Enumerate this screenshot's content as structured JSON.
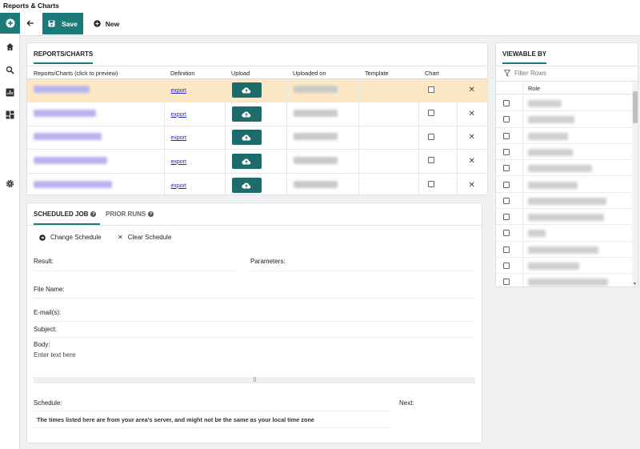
{
  "app": {
    "title": "Reports & Charts"
  },
  "colors": {
    "accent": "#1d7a7a",
    "selected_row": "#fde8c6",
    "link": "#2323cc"
  },
  "nav": {
    "add_icon": "plus-circle-icon",
    "items": [
      {
        "icon": "home-icon"
      },
      {
        "icon": "search-icon"
      },
      {
        "icon": "bar-chart-icon"
      },
      {
        "icon": "dashboard-icon"
      },
      {
        "icon": "gear-icon"
      }
    ]
  },
  "toolbar": {
    "back_icon": "arrow-left-icon",
    "save_label": "Save",
    "new_label": "New"
  },
  "reports": {
    "tab_label": "REPORTS/CHARTS",
    "columns": [
      "Reports/Charts (click to preview)",
      "Definition",
      "Upload",
      "Uploaded on",
      "Template",
      "Chart"
    ],
    "rows": [
      {
        "definition": "export",
        "selected": true
      },
      {
        "definition": "export",
        "selected": false
      },
      {
        "definition": "export",
        "selected": false
      },
      {
        "definition": "export",
        "selected": false
      },
      {
        "definition": "export",
        "selected": false
      }
    ]
  },
  "schedule": {
    "tabs": [
      {
        "label": "SCHEDULED JOB",
        "active": true
      },
      {
        "label": "PRIOR RUNS",
        "active": false
      }
    ],
    "actions": {
      "change_label": "Change Schedule",
      "clear_label": "Clear Schedule"
    },
    "labels": {
      "result": "Result:",
      "parameters": "Parameters:",
      "file_name": "File Name:",
      "emails": "E-mail(s):",
      "subject": "Subject:",
      "body": "Body:",
      "schedule": "Schedule:",
      "next": "Next:"
    },
    "body_placeholder": "Enter text here",
    "timezone_note": "The times listed here are from your area's server, and might not be the same as your local time zone"
  },
  "viewable_by": {
    "tab_label": "VIEWABLE BY",
    "filter_placeholder": "Filter Rows",
    "role_header": "Role",
    "row_count": 12
  }
}
